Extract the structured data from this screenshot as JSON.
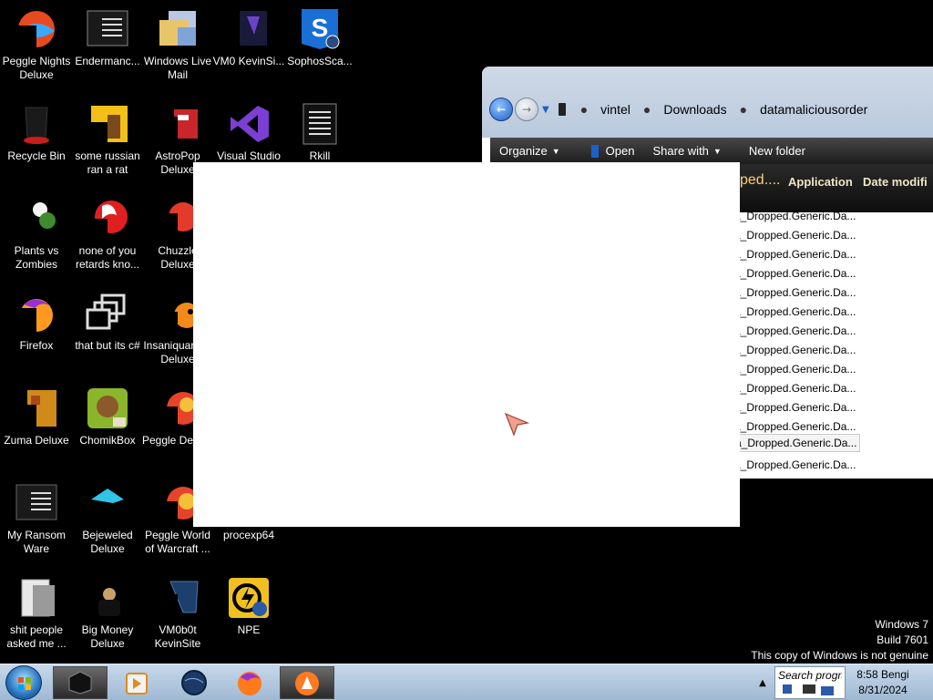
{
  "desktop": {
    "icons": [
      {
        "label": "Peggle Nights Deluxe"
      },
      {
        "label": "Endermanc..."
      },
      {
        "label": "Windows Live Mail"
      },
      {
        "label": "VM0 KevinSi..."
      },
      {
        "label": "SophosSca..."
      },
      {
        "label": "Recycle Bin"
      },
      {
        "label": "some russian ran a rat"
      },
      {
        "label": "AstroPop Deluxe"
      },
      {
        "label": "Visual Studio"
      },
      {
        "label": "Rkill"
      },
      {
        "label": "Plants vs Zombies"
      },
      {
        "label": "none of you retards kno..."
      },
      {
        "label": "Chuzzle Deluxe"
      },
      {
        "label": "Firefox"
      },
      {
        "label": "that but its c#"
      },
      {
        "label": "Insaniquarium Deluxe"
      },
      {
        "label": "Zuma Deluxe"
      },
      {
        "label": "ChomikBox"
      },
      {
        "label": "Peggle Deluxe"
      },
      {
        "label": "My Ransom Ware"
      },
      {
        "label": "Bejeweled Deluxe"
      },
      {
        "label": "Peggle World of Warcraft ..."
      },
      {
        "label": "procexp64"
      },
      {
        "label": "shit people asked me ..."
      },
      {
        "label": "Big Money Deluxe"
      },
      {
        "label": "VM0b0t KevinSite"
      },
      {
        "label": "NPE"
      }
    ]
  },
  "explorer": {
    "breadcrumb": [
      "vintel",
      "Downloads",
      "datamaliciousorder"
    ],
    "commands": {
      "organize": "Organize",
      "open": "Open",
      "share": "Share with",
      "new_folder": "New folder"
    },
    "columns": {
      "name": "ped....",
      "type": "Application",
      "date": "Date modifi"
    },
    "files": [
      "a_Dropped.Generic.Da...",
      "a_Dropped.Generic.Da...",
      "a_Dropped.Generic.Da...",
      "a_Dropped.Generic.Da...",
      "a_Dropped.Generic.Da...",
      "a_Dropped.Generic.Da...",
      "a_Dropped.Generic.Da...",
      "a_Dropped.Generic.Da...",
      "a_Dropped.Generic.Da...",
      "a_Dropped.Generic.Da...",
      "a_Dropped.Generic.Da...",
      "a_Dropped.Generic.Da...",
      "a_Dropped.Generic.Da...",
      "a_Dropped.Generic.Da..."
    ],
    "selected_index": 12
  },
  "watermark": {
    "line1": "Windows 7",
    "line2": "Build 7601",
    "line3": "This copy of Windows is not genuine"
  },
  "taskbar": {
    "search_placeholder": "Search program",
    "clock_time": "8:58 Bengi",
    "clock_date": "8/31/2024"
  },
  "colors": {
    "accent": "#ffcf72",
    "taskbar": "#b4cbe2"
  }
}
